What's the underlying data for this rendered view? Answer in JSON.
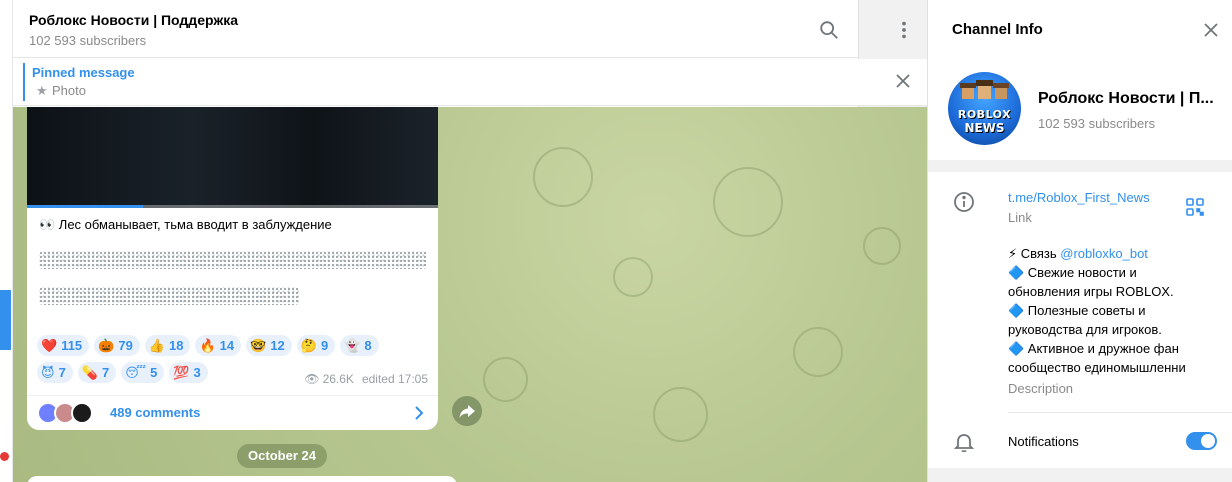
{
  "chat": {
    "title": "Роблокс Новости | Поддержка",
    "subtitle": "102 593 subscribers",
    "pinned": {
      "label": "Pinned message",
      "sub": "Photo"
    },
    "message": {
      "text": "👀 Лес обманывает, тьма вводит в заблуждение",
      "reactions_row1": [
        {
          "emoji": "❤️",
          "count": "115"
        },
        {
          "emoji": "🎃",
          "count": "79"
        },
        {
          "emoji": "👍",
          "count": "18"
        },
        {
          "emoji": "🔥",
          "count": "14"
        },
        {
          "emoji": "🤓",
          "count": "12"
        },
        {
          "emoji": "🤔",
          "count": "9"
        },
        {
          "emoji": "👻",
          "count": "8"
        }
      ],
      "reactions_row2": [
        {
          "emoji": "😈",
          "count": "7"
        },
        {
          "emoji": "💊",
          "count": "7"
        },
        {
          "emoji": "😴",
          "count": "5"
        },
        {
          "emoji": "💯",
          "count": "3"
        }
      ],
      "views": "26.6K",
      "edited": "edited 17:05",
      "comments_label": "489 comments"
    },
    "date_pill": "October 24"
  },
  "panel": {
    "title": "Channel Info",
    "name": "Роблокс Новости | П...",
    "subs": "102 593 subscribers",
    "avatar": {
      "line1": "ROBLOX",
      "line2": "NEWS"
    },
    "link": "t.me/Roblox_First_News",
    "link_sub": "Link",
    "desc_line1_prefix": "⚡ Связь ",
    "desc_mention": "@robloxko_bot",
    "desc_rest": [
      "🔷 Свежие новости и",
      "обновления игры ROBLOX.",
      "🔷 Полезные советы и",
      "руководства для игроков.",
      "🔷 Активное и дружное фан",
      "сообщество единомышленни"
    ],
    "desc_sub": "Description",
    "notifications": "Notifications",
    "notifications_on": true
  },
  "colors": {
    "accent": "#3390ec",
    "chat_bg": "#b9c993",
    "muted": "#8a8a8a"
  },
  "icons": [
    "search-icon",
    "sidebar-toggle-icon",
    "more-vertical-icon",
    "close-icon",
    "pin-icon",
    "eye-icon",
    "chevron-right-icon",
    "share-icon",
    "info-icon",
    "qr-code-icon",
    "bell-icon"
  ]
}
